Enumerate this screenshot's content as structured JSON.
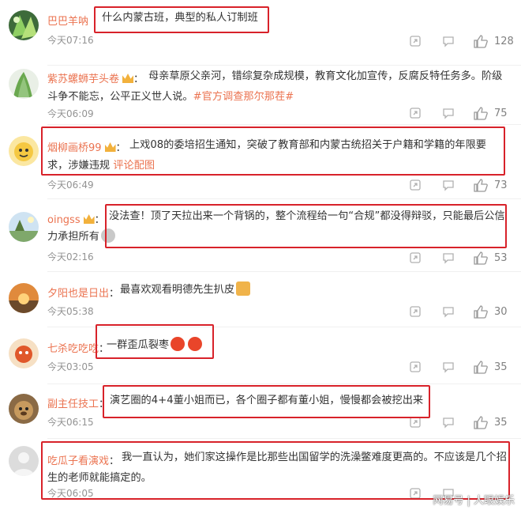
{
  "comments": [
    {
      "user": "巴巴羊呐",
      "badge": false,
      "text": "什么内蒙古班，典型的私人订制班",
      "time": "今天07:16",
      "likes": "128"
    },
    {
      "user": "紫苏螺蛳芋头卷",
      "badge": true,
      "text": "母亲草原父亲河，错综复杂成规模，教育文化加宣传，反腐反特任务多。阶级斗争不能忘，公平正义世人说。",
      "tag": "#官方调查那尔那茬#",
      "time": "今天06:09",
      "likes": "75"
    },
    {
      "user": "烟柳画桥99",
      "badge": true,
      "text": "上戏08的委培招生通知，突破了教育部和内蒙古统招关于户籍和学籍的年限要求，涉嫌违规",
      "link": "评论配图",
      "time": "今天06:49",
      "likes": "73"
    },
    {
      "user": "oingss",
      "badge": true,
      "text": "没法查！顶了天拉出来一个背锅的，整个流程给一句“合规”都没得辩驳，只能最后公信力承担所有",
      "time": "今天02:16",
      "likes": "53"
    },
    {
      "user": "夕阳也是日出",
      "badge": false,
      "text": "最喜欢观看明德先生扒皮",
      "time": "今天05:38",
      "likes": "30"
    },
    {
      "user": "七杀吃吃吃",
      "badge": false,
      "text": "一群歪瓜裂枣",
      "time": "今天03:05",
      "likes": "35"
    },
    {
      "user": "副主任技工",
      "badge": false,
      "text": "演艺圈的4+4董小姐而已，各个圈子都有董小姐，慢慢都会被挖出来",
      "time": "今天06:15",
      "likes": "35"
    },
    {
      "user": "吃瓜子看演戏",
      "badge": false,
      "text": "我一直认为，她们家这操作是比那些出国留学的洗澡鳖难度更高的。不应该是几个招生的老师就能搞定的。",
      "time": "今天06:05",
      "likes": "35"
    }
  ],
  "watermark": "网易号 | 人眼娱乐",
  "colors": {
    "username": "#eb7350",
    "highlight_box": "#d8222a",
    "time": "#939393"
  }
}
